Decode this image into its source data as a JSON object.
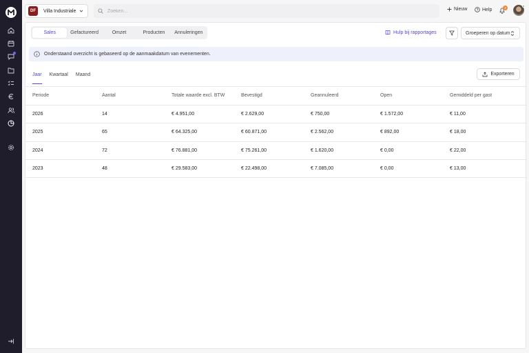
{
  "sidebar": {
    "logo_letter": "M",
    "items": [
      {
        "icon": "home-icon"
      },
      {
        "icon": "calendar-icon"
      },
      {
        "icon": "chat-icon",
        "has_badge": true
      },
      {
        "icon": "folder-icon"
      },
      {
        "icon": "checklist-icon"
      },
      {
        "icon": "euro-icon"
      },
      {
        "icon": "users-icon"
      },
      {
        "icon": "reports-icon",
        "active": true
      },
      {
        "icon": "settings-icon"
      }
    ],
    "footer_icon": "logout-icon"
  },
  "topbar": {
    "venue_initials": "DF",
    "venue_name": "Villa Industriale",
    "search_placeholder": "Zoeken...",
    "new_label": "Nieuw",
    "help_label": "Help",
    "notification_count": "3"
  },
  "report_tabs": [
    "Sales",
    "Gefactureerd",
    "Omzet",
    "Producten",
    "Annuleringen"
  ],
  "active_report_tab": "Sales",
  "help_link": "Hulp bij rapportages",
  "group_by": "Groeperen op datum",
  "info_text": "Onderstaand overzicht is gebaseerd op de aanmaakdatum van evenementen.",
  "period_tabs": [
    "Jaar",
    "Kwartaal",
    "Maand"
  ],
  "active_period_tab": "Jaar",
  "export_label": "Exporteren",
  "table": {
    "headers": [
      "Periode",
      "Aantal",
      "Totale waarde excl. BTW",
      "Bevestigd",
      "Geannuleerd",
      "Open",
      "Gemiddeld per gast"
    ],
    "rows": [
      [
        "2026",
        "14",
        "€ 4.951,00",
        "€ 2.629,00",
        "€ 750,00",
        "€ 1.572,00",
        "€ 11,00"
      ],
      [
        "2025",
        "65",
        "€ 64.325,00",
        "€ 60.871,00",
        "€ 2.562,00",
        "€ 892,00",
        "€ 18,00"
      ],
      [
        "2024",
        "72",
        "€ 76.881,00",
        "€ 75.261,00",
        "€ 1.620,00",
        "€ 0,00",
        "€ 22,00"
      ],
      [
        "2023",
        "48",
        "€ 29.583,00",
        "€ 22.498,00",
        "€ 7.085,00",
        "€ 0,00",
        "€ 13,00"
      ]
    ]
  },
  "colors": {
    "sidebar": "#1f1d2b",
    "accent": "#4f46e5",
    "venue_badge": "#8b1d1d",
    "notification": "#e8883a"
  }
}
